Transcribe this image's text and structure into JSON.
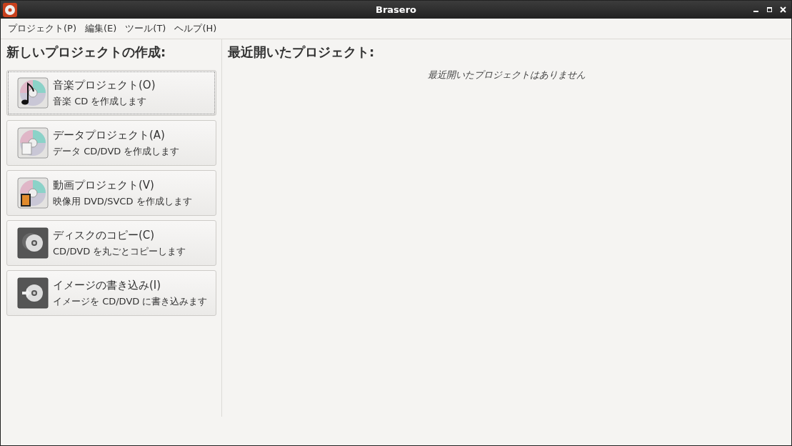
{
  "window": {
    "title": "Brasero"
  },
  "menu": [
    "プロジェクト(P)",
    "編集(E)",
    "ツール(T)",
    "ヘルプ(H)"
  ],
  "new_project": {
    "heading": "新しいプロジェクトの作成:",
    "items": [
      {
        "kind": "music",
        "title": "音楽プロジェクト(O)",
        "description": "音楽 CD を作成します",
        "focused": true
      },
      {
        "kind": "data",
        "title": "データプロジェクト(A)",
        "description": "データ CD/DVD を作成します",
        "focused": false
      },
      {
        "kind": "video",
        "title": "動画プロジェクト(V)",
        "description": "映像用 DVD/SVCD を作成します",
        "focused": false
      },
      {
        "kind": "copy",
        "title": "ディスクのコピー(C)",
        "description": "CD/DVD を丸ごとコピーします",
        "focused": false
      },
      {
        "kind": "image",
        "title": "イメージの書き込み(I)",
        "description": "イメージを CD/DVD に書き込みます",
        "focused": false
      }
    ]
  },
  "recent": {
    "heading": "最近開いたプロジェクト:",
    "empty_message": "最近開いたプロジェクトはありません"
  }
}
